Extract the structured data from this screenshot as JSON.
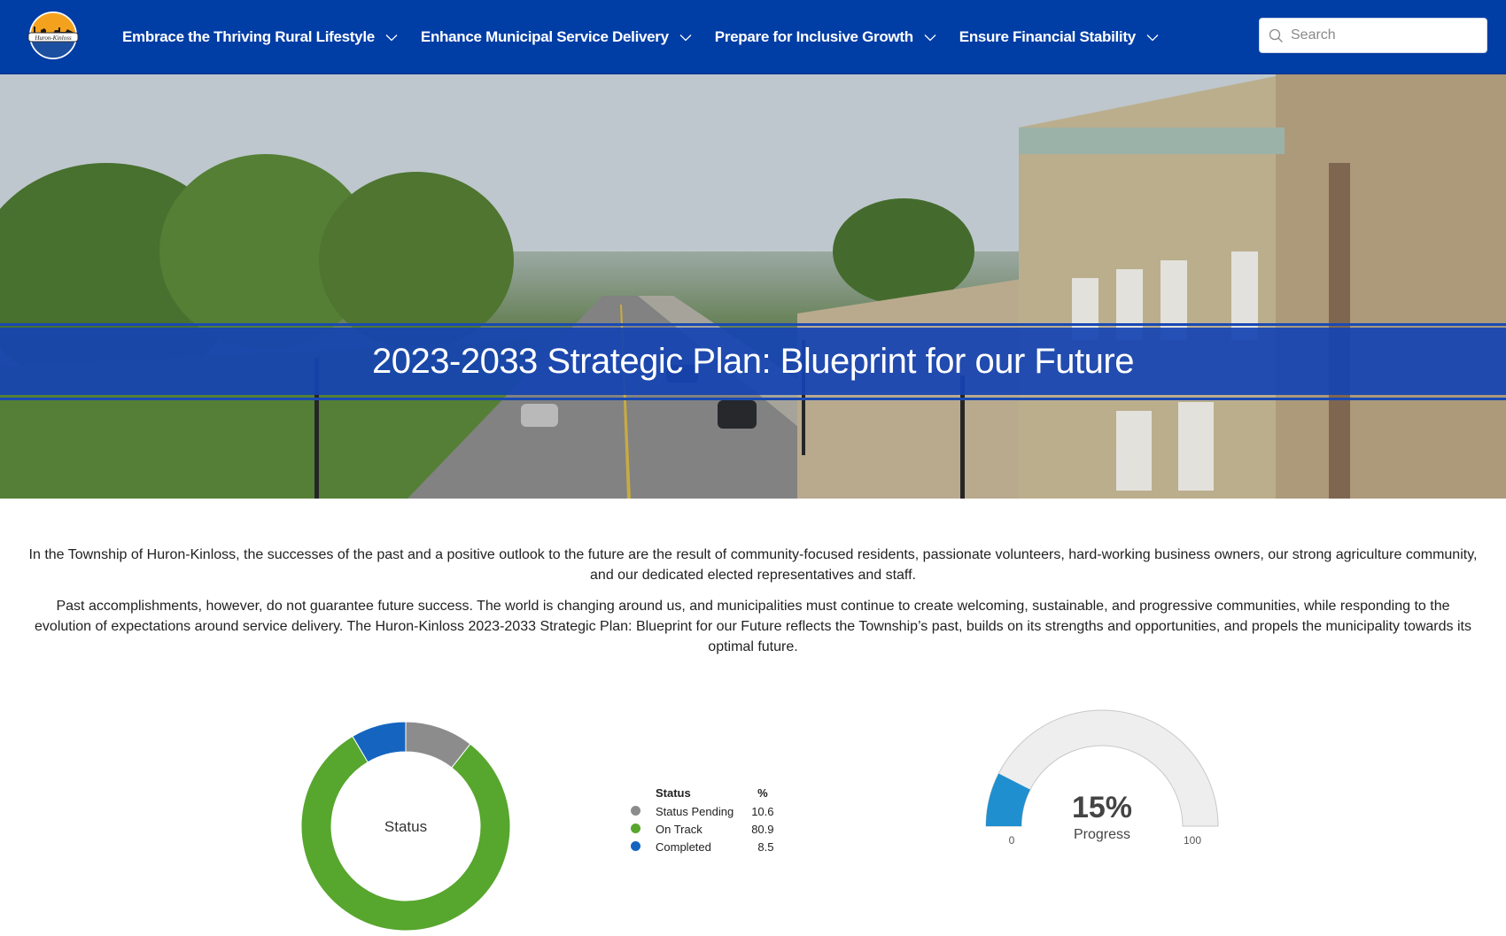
{
  "header": {
    "logo_alt": "Huron-Kinloss",
    "nav": [
      {
        "label": "Embrace the Thriving Rural Lifestyle",
        "icon": "chevron-down-icon"
      },
      {
        "label": "Enhance Municipal Service Delivery",
        "icon": "chevron-down-icon"
      },
      {
        "label": "Prepare for Inclusive Growth",
        "icon": "chevron-down-icon"
      },
      {
        "label": "Ensure Financial Stability",
        "icon": "chevron-down-icon"
      }
    ],
    "search": {
      "placeholder": "Search",
      "value": "",
      "icon": "search-icon"
    }
  },
  "hero": {
    "title": "2023-2033 Strategic Plan: Blueprint for our Future"
  },
  "intro": {
    "paragraphs": [
      "In the Township of Huron-Kinloss, the successes of the past and a positive outlook to the future are the result of community-focused residents, passionate volunteers, hard-working business owners, our strong agriculture community, and our dedicated elected representatives and staff.",
      "Past accomplishments, however, do not guarantee future success. The world is changing around us, and municipalities must continue to create welcoming, sustainable, and progressive communities, while responding to the evolution of expectations around service delivery. The Huron-Kinloss 2023-2033 Strategic Plan: Blueprint for our Future reflects the Township’s past, builds on its strengths and opportunities, and propels the municipality towards its optimal future."
    ]
  },
  "colors": {
    "header_bg": "#003da5",
    "banner_bg": "#1543b2",
    "pending": "#8c8c8c",
    "on_track": "#57a62e",
    "completed": "#1565c0",
    "gauge_fill": "#1f8fd0",
    "gauge_track": "#eeeeee"
  },
  "chart_data": [
    {
      "type": "pie",
      "variant": "donut",
      "center_label": "Status",
      "legend_header": {
        "label": "Status",
        "value": "%"
      },
      "legend_position": "right",
      "categories": [
        "Status Pending",
        "On Track",
        "Completed"
      ],
      "values": [
        10.6,
        80.9,
        8.5
      ],
      "value_labels": [
        "10.6",
        "80.9",
        "8.5"
      ],
      "colors": [
        "#8c8c8c",
        "#57a62e",
        "#1565c0"
      ]
    },
    {
      "type": "gauge",
      "value": 15,
      "value_label": "15%",
      "label": "Progress",
      "min": 0,
      "max": 100,
      "min_label": "0",
      "max_label": "100"
    }
  ]
}
